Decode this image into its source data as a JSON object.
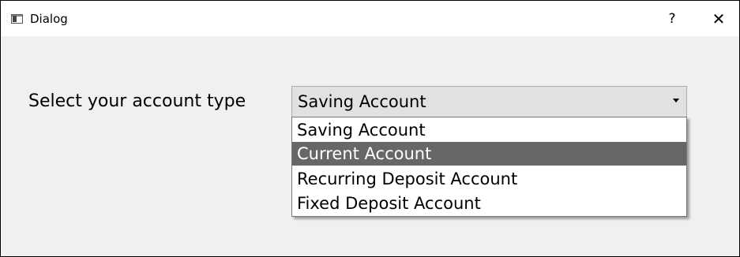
{
  "window": {
    "title": "Dialog",
    "help_label": "?",
    "close_label": "✕"
  },
  "form": {
    "label": "Select your account type",
    "combo": {
      "selected_value": "Saving Account",
      "options": [
        "Saving Account",
        "Current Account",
        "Recurring Deposit Account",
        "Fixed Deposit Account"
      ],
      "highlighted_option": "Current Account"
    }
  },
  "colors": {
    "highlight": "#676767",
    "combo_background": "#e1e1e1",
    "window_background": "#f0f0f0"
  }
}
